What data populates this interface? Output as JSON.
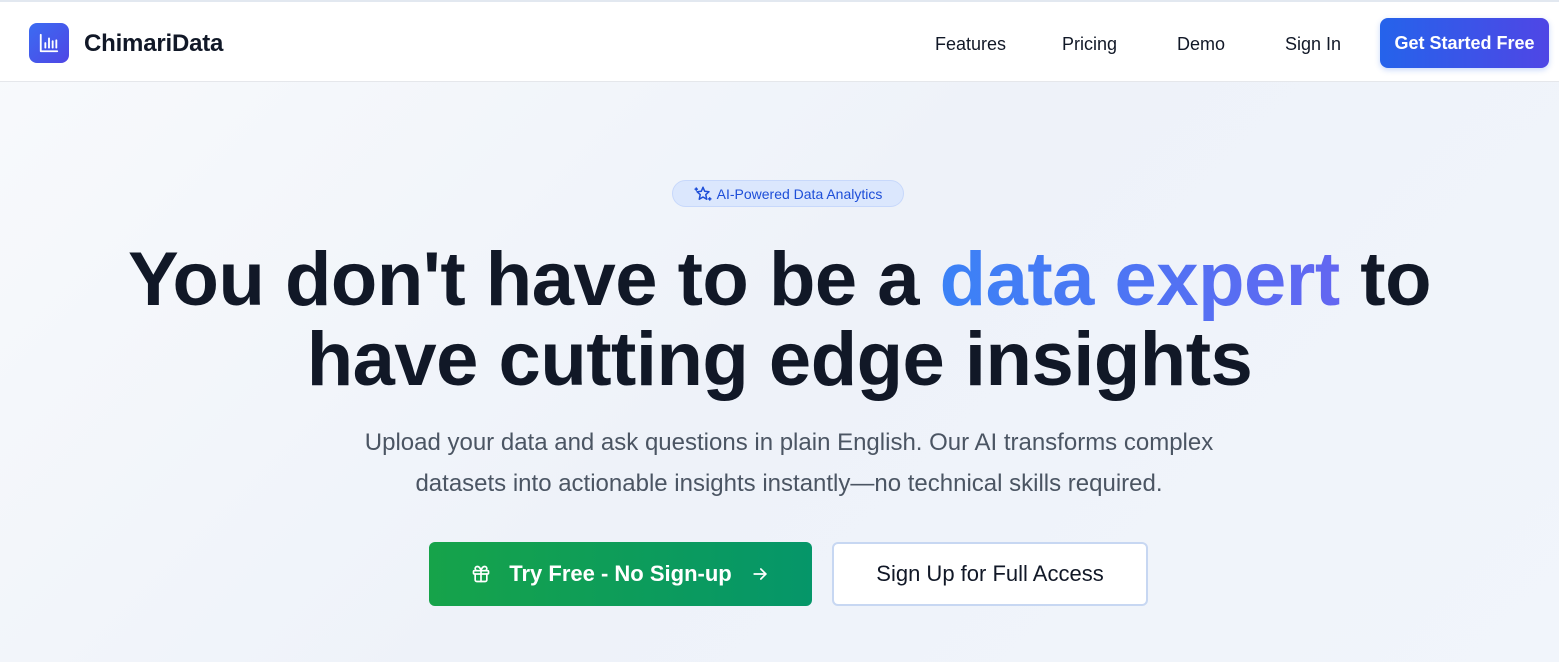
{
  "header": {
    "brand": "ChimariData",
    "nav": {
      "features": "Features",
      "pricing": "Pricing",
      "demo": "Demo",
      "signin": "Sign In"
    },
    "cta": "Get Started Free",
    "logo_icon": "bar-chart-icon"
  },
  "hero": {
    "badge": {
      "icon": "sparkles-icon",
      "text": "AI-Powered Data Analytics"
    },
    "headline": {
      "part1": "You don't have to be a ",
      "accent": "data expert",
      "part2": " to",
      "line2": "have cutting edge insights"
    },
    "subtitle": "Upload your data and ask questions in plain English. Our AI transforms complex datasets into actionable insights instantly—no technical skills required.",
    "primary_button": {
      "label": "Try Free - No Sign-up",
      "left_icon": "gift-icon",
      "right_icon": "arrow-right-icon"
    },
    "secondary_button": {
      "label": "Sign Up for Full Access"
    }
  },
  "colors": {
    "brand_gradient_start": "#2563eb",
    "brand_gradient_end": "#4f46e5",
    "accent_text_start": "#3b82f6",
    "accent_text_end": "#6366f1",
    "primary_green_start": "#16a34a",
    "primary_green_end": "#059669",
    "headline_text": "#111827",
    "subtitle_text": "#4b5563"
  }
}
